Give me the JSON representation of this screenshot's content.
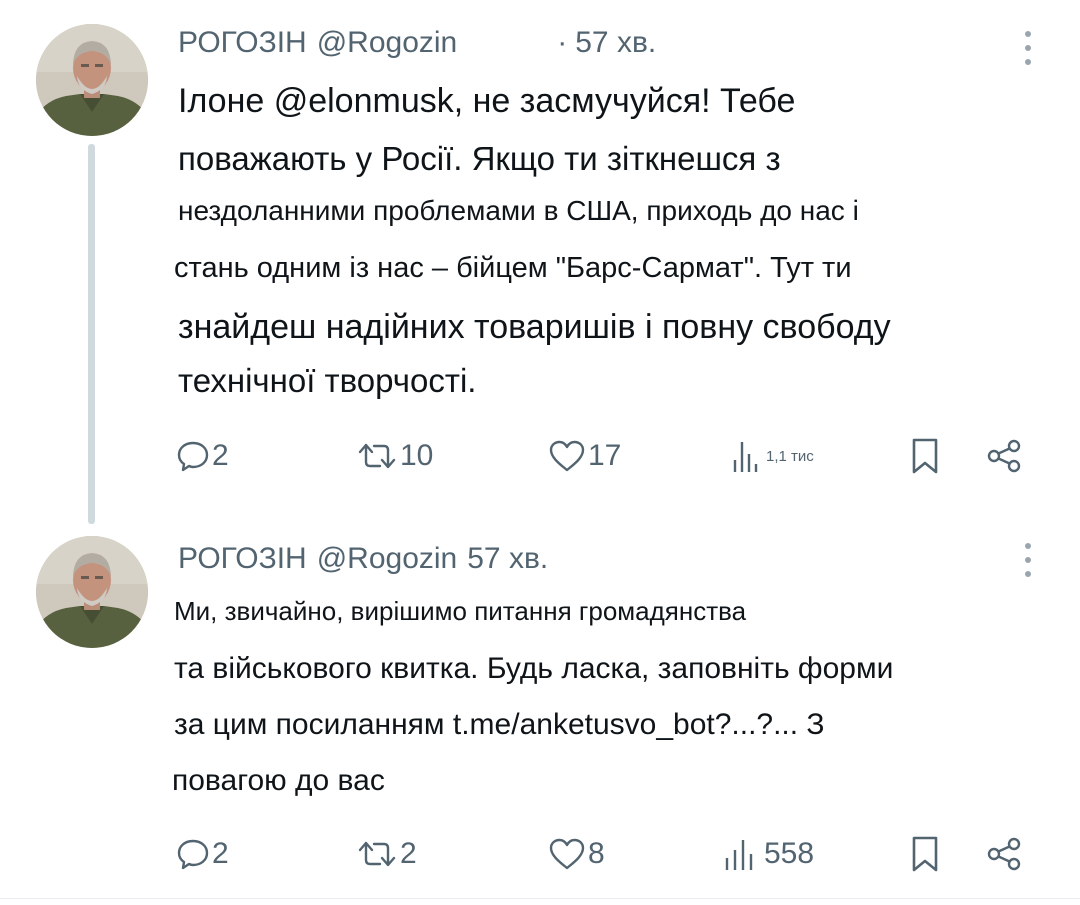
{
  "tweets": [
    {
      "display_name": "РОГОЗІН",
      "handle": "@Rogozin",
      "separator": "·",
      "time": "57 хв.",
      "text_lines": [
        "Ілоне @elonmusk, не засмучуйся! Тебе",
        "поважають у Росії. Якщо ти зіткнешся з",
        "нездоланними проблемами в США, приходь до нас і",
        "стань одним із нас – бійцем \"Барс-Сармат\". Тут ти",
        "знайдеш надійних товаришів і повну свободу",
        "технічної творчості."
      ],
      "actions": {
        "replies": "2",
        "reposts": "10",
        "likes": "17",
        "views": "1,1 тис"
      }
    },
    {
      "display_name": "РОГОЗІН",
      "handle": "@Rogozin",
      "time": "57 хв.",
      "text_lines": [
        "Ми, звичайно, вирішимо питання громадянства",
        "та військового квитка. Будь ласка, заповніть форми",
        "за цим посиланням t.me/anketusvo_bot?...?... З",
        "повагою до вас"
      ],
      "actions": {
        "replies": "2",
        "reposts": "2",
        "likes": "8",
        "views": "558"
      }
    }
  ],
  "icons": {
    "reply": "speech-bubble-icon",
    "repost": "repost-arrows-icon",
    "like": "heart-icon",
    "views": "bar-chart-icon",
    "bookmark": "bookmark-icon",
    "share": "share-nodes-icon",
    "more": "vertical-dots-icon"
  },
  "colors": {
    "text": "#0f1419",
    "secondary": "#536471",
    "thread_line": "#cfd9de"
  }
}
